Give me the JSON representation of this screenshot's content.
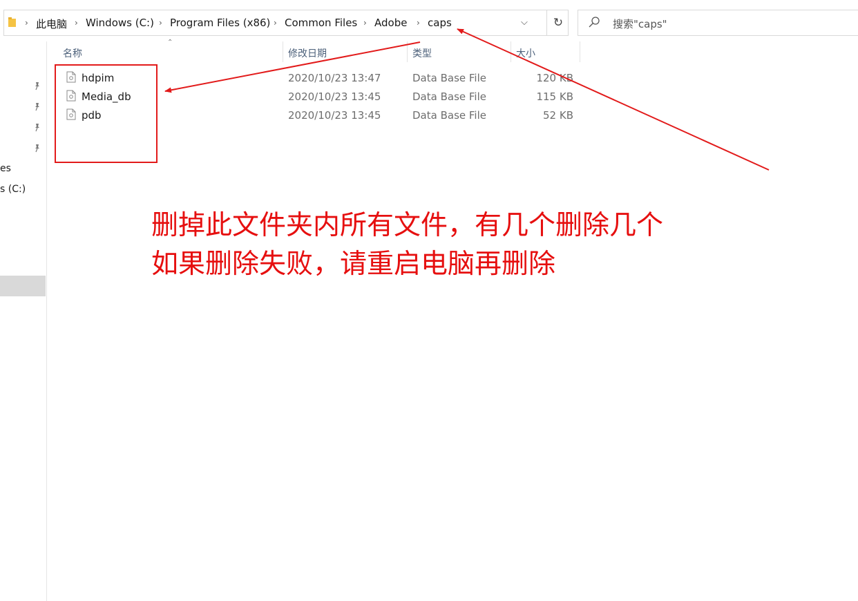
{
  "address_bar": {
    "crumbs": [
      "此电脑",
      "Windows (C:)",
      "Program Files (x86)",
      "Common Files",
      "Adobe",
      "caps"
    ],
    "dropdown_icon": "chevron-down-icon",
    "refresh_icon": "refresh-icon"
  },
  "search": {
    "placeholder": "搜索\"caps\""
  },
  "nav_pane": {
    "items": [
      "es",
      "s (C:)"
    ]
  },
  "columns": [
    "名称",
    "修改日期",
    "类型",
    "大小"
  ],
  "files": [
    {
      "name": "hdpim",
      "date": "2020/10/23 13:47",
      "type": "Data Base File",
      "size": "120 KB"
    },
    {
      "name": "Media_db",
      "date": "2020/10/23 13:45",
      "type": "Data Base File",
      "size": "115 KB"
    },
    {
      "name": "pdb",
      "date": "2020/10/23 13:45",
      "type": "Data Base File",
      "size": "52 KB"
    }
  ],
  "annotation": {
    "line1": "删掉此文件夹内所有文件，有几个删除几个",
    "line2": "如果删除失败，请重启电脑再删除",
    "color": "#e60f0f"
  }
}
